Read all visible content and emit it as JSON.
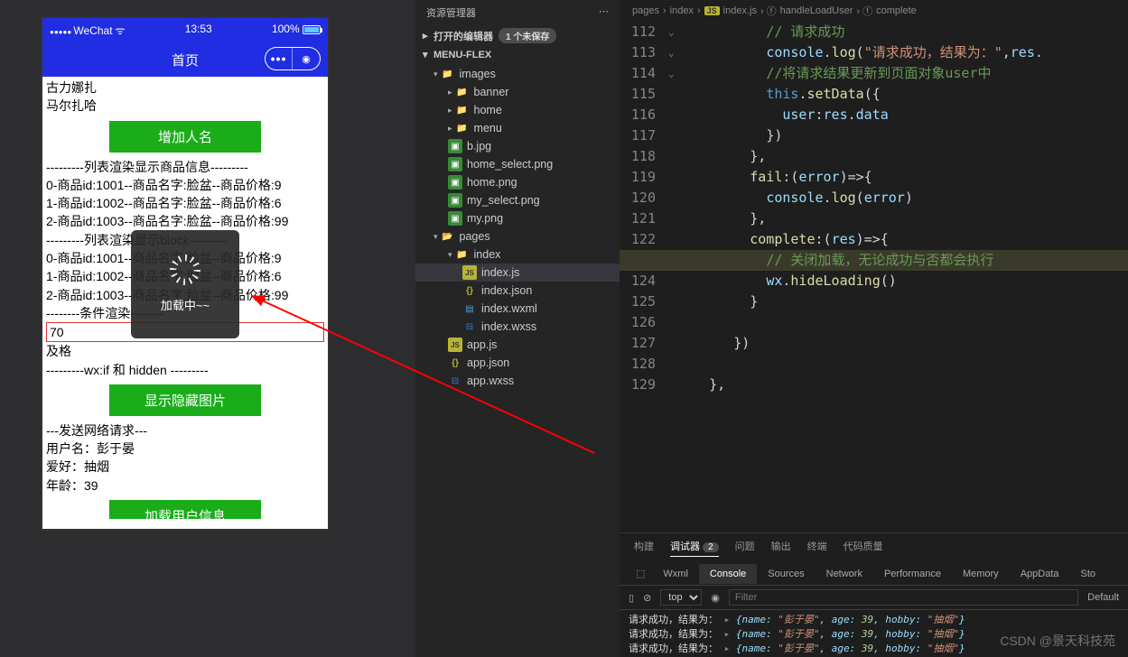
{
  "simulator": {
    "statusbar": {
      "carrier": "WeChat",
      "time": "13:53",
      "battery": "100%"
    },
    "title": "首页",
    "names": [
      "古力娜扎",
      "马尔扎哈"
    ],
    "btn_add": "增加人名",
    "section_goods": "---------列表渲染显示商品信息---------",
    "goods": [
      "0-商品id:1001--商品名字:脸盆--商品价格:9",
      "1-商品id:1002--商品名字:脸盆--商品价格:6",
      "2-商品id:1003--商品名字:脸盆--商品价格:99"
    ],
    "section_block": "---------列表渲染显示block---------",
    "section_cond": "--------条件渲染--------",
    "score": "70",
    "score_result": "及格",
    "section_if": "---------wx:if 和 hidden ---------",
    "btn_toggle": "显示隐藏图片",
    "section_net": "---发送网络请求---",
    "user_name_label": "用户名：",
    "user_name": "彭于晏",
    "hobby_label": "爱好：",
    "hobby": "抽烟",
    "age_label": "年龄：",
    "age": "39",
    "btn_load": "加载用户信息",
    "loading_text": "加载中~~"
  },
  "explorer": {
    "title": "资源管理器",
    "open_editors": "打开的编辑器",
    "unsaved_badge": "1 个未保存",
    "project": "MENU-FLEX",
    "tree": {
      "images": {
        "banner": "banner",
        "home": "home",
        "menu": "menu",
        "files": [
          "b.jpg",
          "home_select.png",
          "home.png",
          "my_select.png",
          "my.png"
        ]
      },
      "pages": {
        "index": [
          "index.js",
          "index.json",
          "index.wxml",
          "index.wxss"
        ]
      },
      "root_files": [
        "app.js",
        "app.json",
        "app.wxss"
      ]
    }
  },
  "editor": {
    "breadcrumb": [
      "pages",
      "index",
      "index.js",
      "handleLoadUser",
      "complete"
    ],
    "lines": [
      {
        "n": 112,
        "html": "          <span class='tk-com'>// 请求成功</span>"
      },
      {
        "n": 113,
        "html": "          <span class='tk-var'>console</span><span class='tk-pun'>.</span><span class='tk-fn'>log</span><span class='tk-pun'>(</span><span class='tk-str'>\"请求成功，结果为：\"</span><span class='tk-pun'>,</span><span class='tk-var'>res</span><span class='tk-pun'>.</span>"
      },
      {
        "n": 114,
        "html": "          <span class='tk-com'>//将请求结果更新到页面对象user中</span>"
      },
      {
        "n": 115,
        "html": "          <span class='tk-kw'>this</span><span class='tk-pun'>.</span><span class='tk-fn'>setData</span><span class='tk-pun'>({</span>",
        "fold": true
      },
      {
        "n": 116,
        "html": "            <span class='tk-prop'>user</span><span class='tk-pun'>:</span><span class='tk-var'>res</span><span class='tk-pun'>.</span><span class='tk-var'>data</span>"
      },
      {
        "n": 117,
        "html": "          <span class='tk-pun'>})</span>"
      },
      {
        "n": 118,
        "html": "        <span class='tk-pun'>},</span>"
      },
      {
        "n": 119,
        "html": "        <span class='tk-fn'>fail</span><span class='tk-pun'>:(</span><span class='tk-var'>error</span><span class='tk-pun'>)=>{</span>",
        "fold": true
      },
      {
        "n": 120,
        "html": "          <span class='tk-var'>console</span><span class='tk-pun'>.</span><span class='tk-fn'>log</span><span class='tk-pun'>(</span><span class='tk-var'>error</span><span class='tk-pun'>)</span>"
      },
      {
        "n": 121,
        "html": "        <span class='tk-pun'>},</span>"
      },
      {
        "n": 122,
        "html": "        <span class='tk-fn'>complete</span><span class='tk-pun'>:(</span><span class='tk-var'>res</span><span class='tk-pun'>)=>{</span>",
        "fold": true
      },
      {
        "n": 123,
        "html": "          <span class='tk-com'>// 关闭加载，无论成功与否都会执行</span>",
        "cur": true
      },
      {
        "n": 124,
        "html": "          <span class='tk-var'>wx</span><span class='tk-pun'>.</span><span class='tk-fn'>hideLoading</span><span class='tk-pun'>()</span>"
      },
      {
        "n": 125,
        "html": "        <span class='tk-pun'>}</span>"
      },
      {
        "n": 126,
        "html": ""
      },
      {
        "n": 127,
        "html": "      <span class='tk-pun'>})</span>"
      },
      {
        "n": 128,
        "html": ""
      },
      {
        "n": 129,
        "html": "   <span class='tk-pun'>},</span>"
      }
    ]
  },
  "bottom": {
    "tabs": [
      "构建",
      "调试器",
      "问题",
      "输出",
      "终端",
      "代码质量"
    ],
    "debugger_count": "2",
    "dev_tabs": [
      "Wxml",
      "Console",
      "Sources",
      "Network",
      "Performance",
      "Memory",
      "AppData",
      "Sto"
    ],
    "active_dev_tab": "Console",
    "context": "top",
    "filter_placeholder": "Filter",
    "default_label": "Default",
    "console": [
      {
        "prefix": "请求成功，结果为：",
        "obj": "{name: \"彭于晏\", age: 39, hobby: \"抽烟\"}"
      },
      {
        "prefix": "请求成功，结果为：",
        "obj": "{name: \"彭于晏\", age: 39, hobby: \"抽烟\"}"
      },
      {
        "prefix": "请求成功，结果为：",
        "obj": "{name: \"彭于晏\", age: 39, hobby: \"抽烟\"}"
      }
    ]
  },
  "watermark": "CSDN @景天科技苑"
}
